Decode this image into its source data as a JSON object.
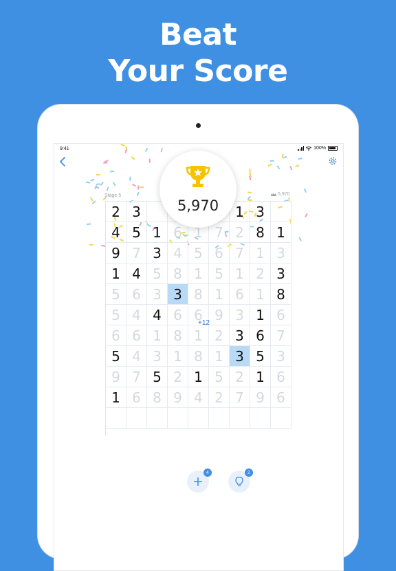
{
  "headline": {
    "line1": "Beat",
    "line2": "Your Score"
  },
  "status_bar": {
    "time": "9:41",
    "battery": "100%"
  },
  "game": {
    "score": "5,970",
    "stage": "Stage 5",
    "best_score": "5,970",
    "floating_points": "+12",
    "grid": [
      [
        {
          "v": "2",
          "f": false
        },
        {
          "v": "3",
          "f": false
        },
        {
          "v": "",
          "f": true
        },
        {
          "v": "",
          "f": true
        },
        {
          "v": "",
          "f": true
        },
        {
          "v": "",
          "f": true
        },
        {
          "v": "1",
          "f": false
        },
        {
          "v": "3",
          "f": false
        },
        {
          "v": "",
          "f": true
        }
      ],
      [
        {
          "v": "4",
          "f": false
        },
        {
          "v": "5",
          "f": false
        },
        {
          "v": "1",
          "f": false
        },
        {
          "v": "6",
          "f": true
        },
        {
          "v": "1",
          "f": true
        },
        {
          "v": "7",
          "f": true
        },
        {
          "v": "2",
          "f": true
        },
        {
          "v": "8",
          "f": false
        },
        {
          "v": "1",
          "f": false
        }
      ],
      [
        {
          "v": "9",
          "f": false
        },
        {
          "v": "7",
          "f": true
        },
        {
          "v": "3",
          "f": false
        },
        {
          "v": "4",
          "f": true
        },
        {
          "v": "5",
          "f": true
        },
        {
          "v": "6",
          "f": true
        },
        {
          "v": "7",
          "f": true
        },
        {
          "v": "1",
          "f": true
        },
        {
          "v": "3",
          "f": true
        }
      ],
      [
        {
          "v": "1",
          "f": false
        },
        {
          "v": "4",
          "f": false
        },
        {
          "v": "5",
          "f": true
        },
        {
          "v": "8",
          "f": true
        },
        {
          "v": "1",
          "f": true
        },
        {
          "v": "5",
          "f": true
        },
        {
          "v": "1",
          "f": true
        },
        {
          "v": "2",
          "f": true
        },
        {
          "v": "3",
          "f": false
        }
      ],
      [
        {
          "v": "5",
          "f": true
        },
        {
          "v": "6",
          "f": true
        },
        {
          "v": "3",
          "f": true
        },
        {
          "v": "3",
          "f": false,
          "s": true
        },
        {
          "v": "8",
          "f": true
        },
        {
          "v": "1",
          "f": true
        },
        {
          "v": "6",
          "f": true
        },
        {
          "v": "1",
          "f": true
        },
        {
          "v": "8",
          "f": false
        }
      ],
      [
        {
          "v": "5",
          "f": true
        },
        {
          "v": "4",
          "f": true
        },
        {
          "v": "4",
          "f": false
        },
        {
          "v": "6",
          "f": true
        },
        {
          "v": "6",
          "f": true
        },
        {
          "v": "9",
          "f": true
        },
        {
          "v": "3",
          "f": true
        },
        {
          "v": "1",
          "f": false
        },
        {
          "v": "6",
          "f": true
        }
      ],
      [
        {
          "v": "6",
          "f": true
        },
        {
          "v": "6",
          "f": true
        },
        {
          "v": "1",
          "f": true
        },
        {
          "v": "8",
          "f": true
        },
        {
          "v": "1",
          "f": true
        },
        {
          "v": "2",
          "f": true
        },
        {
          "v": "3",
          "f": false
        },
        {
          "v": "6",
          "f": false
        },
        {
          "v": "7",
          "f": true
        }
      ],
      [
        {
          "v": "5",
          "f": false
        },
        {
          "v": "4",
          "f": true
        },
        {
          "v": "3",
          "f": true
        },
        {
          "v": "1",
          "f": true
        },
        {
          "v": "8",
          "f": true
        },
        {
          "v": "1",
          "f": true
        },
        {
          "v": "3",
          "f": false,
          "s": true
        },
        {
          "v": "5",
          "f": false
        },
        {
          "v": "3",
          "f": true
        }
      ],
      [
        {
          "v": "9",
          "f": true
        },
        {
          "v": "7",
          "f": true
        },
        {
          "v": "5",
          "f": false
        },
        {
          "v": "2",
          "f": true
        },
        {
          "v": "1",
          "f": false
        },
        {
          "v": "5",
          "f": true
        },
        {
          "v": "2",
          "f": true
        },
        {
          "v": "1",
          "f": false
        },
        {
          "v": "6",
          "f": true
        }
      ],
      [
        {
          "v": "1",
          "f": false
        },
        {
          "v": "6",
          "f": true
        },
        {
          "v": "8",
          "f": true
        },
        {
          "v": "9",
          "f": true
        },
        {
          "v": "4",
          "f": true
        },
        {
          "v": "2",
          "f": true
        },
        {
          "v": "7",
          "f": true
        },
        {
          "v": "9",
          "f": true
        },
        {
          "v": "6",
          "f": true
        }
      ],
      [
        {
          "v": "",
          "f": true
        },
        {
          "v": "",
          "f": true
        },
        {
          "v": "",
          "f": true
        },
        {
          "v": "",
          "f": true
        },
        {
          "v": "",
          "f": true
        },
        {
          "v": "",
          "f": true
        },
        {
          "v": "",
          "f": true
        },
        {
          "v": "",
          "f": true
        },
        {
          "v": "",
          "f": true
        }
      ]
    ]
  },
  "controls": {
    "add_rows_count": "4",
    "hint_count": "2"
  },
  "colors": {
    "background": "#3f8fe3",
    "selected": "#b9daf6",
    "accent": "#3f8fe3",
    "trophy": "#f5c300"
  },
  "icons": [
    "back-arrow-icon",
    "settings-gear-icon",
    "trophy-icon",
    "plus-icon",
    "lightbulb-icon",
    "wifi-icon",
    "signal-icon",
    "battery-icon",
    "crown-icon"
  ]
}
